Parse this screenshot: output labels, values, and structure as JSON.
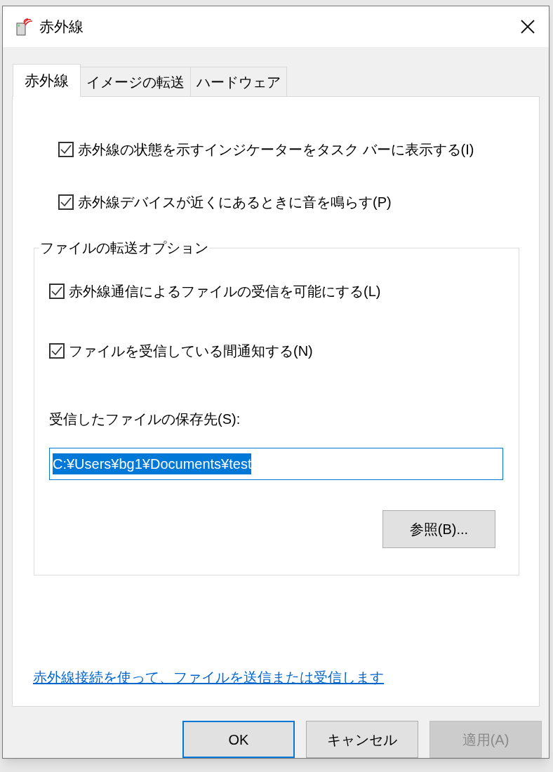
{
  "window": {
    "title": "赤外線"
  },
  "tabs": [
    {
      "label": "赤外線",
      "selected": true
    },
    {
      "label": "イメージの転送",
      "selected": false
    },
    {
      "label": "ハードウェア",
      "selected": false
    }
  ],
  "options": [
    {
      "label": "赤外線の状態を示すインジケーターをタスク バーに表示する(I)",
      "checked": true
    },
    {
      "label": "赤外線デバイスが近くにあるときに音を鳴らす(P)",
      "checked": true
    }
  ],
  "file_transfer": {
    "title": "ファイルの転送オプション",
    "options": [
      {
        "label": "赤外線通信によるファイルの受信を可能にする(L)",
        "checked": true
      },
      {
        "label": "ファイルを受信している間通知する(N)",
        "checked": true
      }
    ],
    "save_label": "受信したファイルの保存先(S):",
    "save_field": {
      "value": "C:¥Users¥bg1¥Documents¥test",
      "selected": true
    },
    "browse_button": "参照(B)..."
  },
  "link": "赤外線接続を使って、ファイルを送信または受信します",
  "buttons": [
    {
      "label": "OK",
      "default": true,
      "disabled": false
    },
    {
      "label": "キャンセル",
      "default": false,
      "disabled": false
    },
    {
      "label": "適用(A)",
      "default": false,
      "disabled": true
    }
  ]
}
